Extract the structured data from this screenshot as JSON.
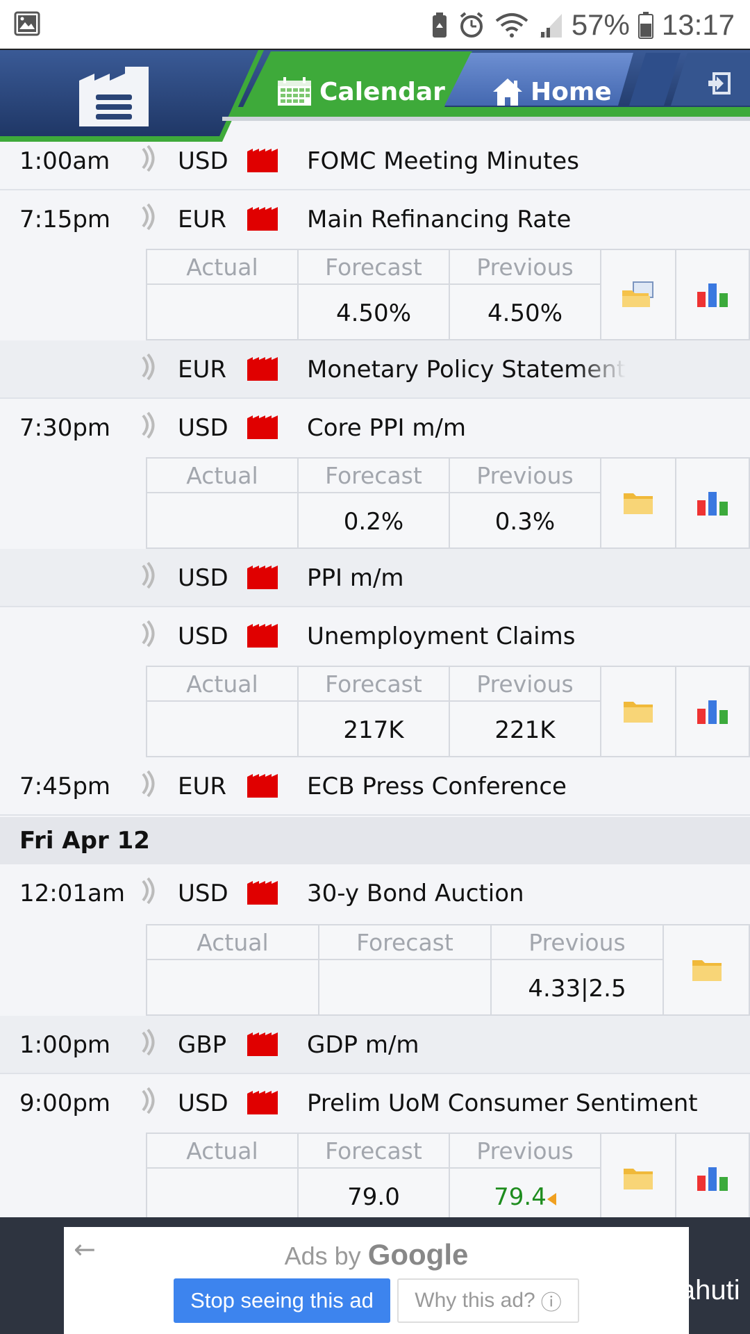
{
  "status_bar": {
    "battery_percent": "57%",
    "time": "13:17",
    "icons": [
      "gallery-icon",
      "battery-saver-icon",
      "alarm-icon",
      "wifi-icon",
      "signal-icon",
      "battery-icon"
    ]
  },
  "header": {
    "tabs": [
      {
        "label": "Calendar",
        "icon": "calendar-icon",
        "active": true
      },
      {
        "label": "Home",
        "icon": "home-icon",
        "active": false
      }
    ],
    "colors": {
      "navy": "#2c4a80",
      "green": "#3eaa3a",
      "tab_blue": "#4f72b8"
    }
  },
  "events": [
    {
      "time": "1:00am",
      "currency": "USD",
      "title": "FOMC Meeting Minutes"
    },
    {
      "time": "7:15pm",
      "currency": "EUR",
      "title": "Main Refinancing Rate",
      "details": {
        "actual": "",
        "forecast": "4.50%",
        "previous": "4.50%"
      }
    },
    {
      "time": "",
      "currency": "EUR",
      "title": "Monetary Policy Statement"
    },
    {
      "time": "7:30pm",
      "currency": "USD",
      "title": "Core PPI m/m",
      "details": {
        "actual": "",
        "forecast": "0.2%",
        "previous": "0.3%"
      }
    },
    {
      "time": "",
      "currency": "USD",
      "title": "PPI m/m"
    },
    {
      "time": "",
      "currency": "USD",
      "title": "Unemployment Claims",
      "details": {
        "actual": "",
        "forecast": "217K",
        "previous": "221K"
      }
    },
    {
      "time": "7:45pm",
      "currency": "EUR",
      "title": "ECB Press Conference"
    },
    {
      "time": "12:01am",
      "currency": "USD",
      "title": "30-y Bond Auction",
      "details": {
        "actual": "",
        "forecast": "",
        "previous": "4.33|2.5"
      }
    },
    {
      "time": "1:00pm",
      "currency": "GBP",
      "title": "GDP m/m"
    },
    {
      "time": "9:00pm",
      "currency": "USD",
      "title": "Prelim UoM Consumer Sentiment",
      "details": {
        "actual": "",
        "forecast": "79.0",
        "previous": "79.4"
      }
    }
  ],
  "day_header": "Fri Apr 12",
  "column_labels": {
    "actual": "Actual",
    "forecast": "Forecast",
    "previous": "Previous"
  },
  "ad": {
    "back_label": "←",
    "title_prefix": "Ads by ",
    "title_brand": "Google",
    "stop_label": "Stop seeing this ad",
    "why_label": "Why this ad?",
    "info_glyph": "ⓘ"
  },
  "watermark": "@Lahuti"
}
